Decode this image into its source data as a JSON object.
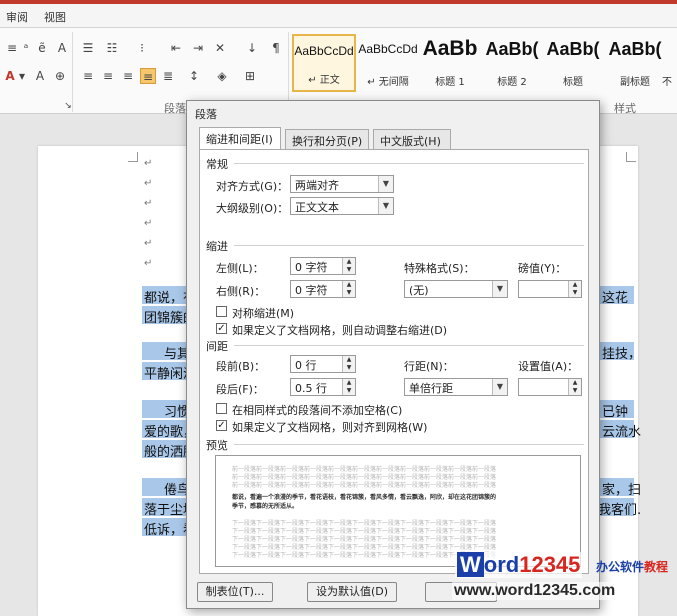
{
  "ribbon": {
    "tabs": [
      "审阅",
      "视图"
    ],
    "group_labels": {
      "paragraph": "段落",
      "styles": "样式"
    },
    "styles": [
      {
        "sample": "AaBbCcDd",
        "name": "↵ 正文"
      },
      {
        "sample": "AaBbCcDd",
        "name": "↵ 无间隔"
      },
      {
        "sample": "AaBb",
        "name": "标题 1"
      },
      {
        "sample": "AaBb(",
        "name": "标题 2"
      },
      {
        "sample": "AaBb(",
        "name": "标题"
      },
      {
        "sample": "AaBb(",
        "name": "副标题"
      },
      {
        "sample": "",
        "name": "不"
      }
    ]
  },
  "document": {
    "para_mark": "↵",
    "lines": [
      {
        "left": "都说，有",
        "right": "这花"
      },
      {
        "left": "团锦簇的",
        "right": ""
      },
      {
        "left": "与其",
        "right": "挂技，"
      },
      {
        "left": "平静闲淡",
        "right": ""
      },
      {
        "left": "习惯",
        "right": "已钟"
      },
      {
        "left": "爱的歌，",
        "right": "云流水"
      },
      {
        "left": "般的洒脱",
        "right": ""
      },
      {
        "left": "倦鸟",
        "right": "家，扫"
      },
      {
        "left": "落于尘埃",
        "right": "我客们."
      },
      {
        "left": "低诉，看",
        "right": ""
      }
    ]
  },
  "dialog": {
    "title": "段落",
    "tabs": [
      "缩进和间距(I)",
      "换行和分页(P)",
      "中文版式(H)"
    ],
    "general": {
      "heading": "常规",
      "alignment_label": "对齐方式(G)：",
      "alignment_value": "两端对齐",
      "outline_label": "大纲级别(O)：",
      "outline_value": "正文文本"
    },
    "indent": {
      "heading": "缩进",
      "left_label": "左侧(L)：",
      "left_value": "0 字符",
      "right_label": "右侧(R)：",
      "right_value": "0 字符",
      "special_label": "特殊格式(S)：",
      "special_value": "(无)",
      "by_label": "磅值(Y)：",
      "by_value": "",
      "mirror_label": "对称缩进(M)",
      "mirror_checked": false,
      "auto_right_label": "如果定义了文档网格，则自动调整右缩进(D)",
      "auto_right_checked": true
    },
    "spacing": {
      "heading": "间距",
      "before_label": "段前(B)：",
      "before_value": "0 行",
      "after_label": "段后(F)：",
      "after_value": "0.5 行",
      "line_label": "行距(N)：",
      "line_value": "单倍行距",
      "at_label": "设置值(A)：",
      "at_value": "",
      "no_space_label": "在相同样式的段落间不添加空格(C)",
      "no_space_checked": false,
      "snap_grid_label": "如果定义了文档网格，则对齐到网格(W)",
      "snap_grid_checked": true
    },
    "preview": {
      "heading": "预览",
      "prev_text": "前一段落前一段落前一段落前一段落前一段落前一段落前一段落前一段落前一段落前一段落前一段落",
      "sample_text_1": "都说，看遍一个浪漫的季节，看花语枝，看花锦簇，看风多情，看云飘逸，阿欣，却在这花团锦簇的",
      "sample_text_2": "季节，感慕的无所适从。",
      "next_text": "下一段落下一段落下一段落下一段落下一段落下一段落下一段落下一段落下一段落下一段落下一段落"
    },
    "buttons": {
      "tabs": "制表位(T)...",
      "default": "设为默认值(D)",
      "ok": ""
    }
  },
  "watermark": {
    "brand_w": "W",
    "brand_ord": "ord",
    "brand_num": "12345",
    "suffix_blue": "办公软件",
    "suffix_red": "教程",
    "url": "www.word12345.com"
  },
  "colors": {
    "selection": "#a9c7e8",
    "ribbon_accent": "#c0392b",
    "brand_blue": "#1a3fa8",
    "brand_red": "#d8261f"
  }
}
